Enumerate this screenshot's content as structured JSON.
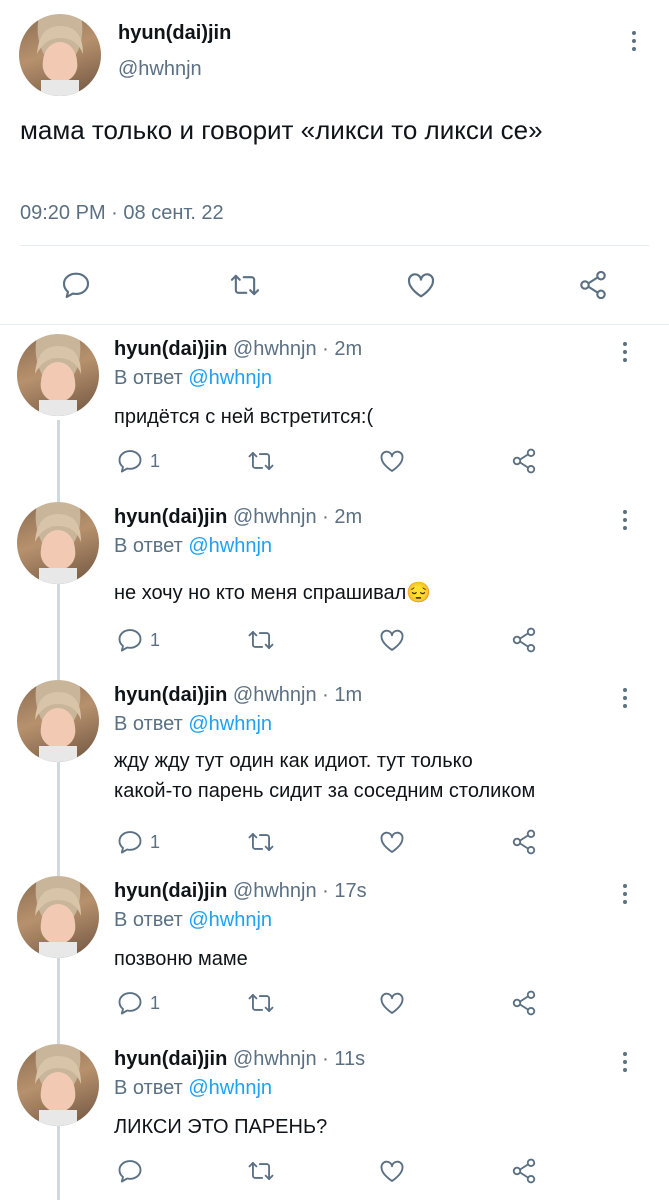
{
  "main_tweet": {
    "name": "hyun(dai)jin",
    "handle": "@hwhnjn",
    "text": "мама только и говорит «ликси то ликси се»",
    "time": "09:20 PM",
    "sep": "·",
    "date": "08 сент. 22"
  },
  "icons": {
    "reply": "reply-icon",
    "retweet": "retweet-icon",
    "like": "heart-icon",
    "share": "share-icon",
    "more": "more-vertical-icon"
  },
  "colors": {
    "link": "#1da1f2",
    "muted": "#5b7083",
    "divider": "#e6ecf0"
  },
  "replies": [
    {
      "name": "hyun(dai)jin",
      "handle": "@hwhnjn",
      "sep": "·",
      "age": "2m",
      "reply_prefix": "В ответ",
      "reply_to": "@hwhnjn",
      "lines": [
        "придётся с ней встретится:("
      ],
      "reply_count": "1"
    },
    {
      "name": "hyun(dai)jin",
      "handle": "@hwhnjn",
      "sep": "·",
      "age": "2m",
      "reply_prefix": "В ответ",
      "reply_to": "@hwhnjn",
      "lines": [
        "не хочу но кто меня спрашивал😔"
      ],
      "reply_count": "1"
    },
    {
      "name": "hyun(dai)jin",
      "handle": "@hwhnjn",
      "sep": "·",
      "age": "1m",
      "reply_prefix": "В ответ",
      "reply_to": "@hwhnjn",
      "lines": [
        "жду жду тут один как идиот. тут только",
        "какой-то парень сидит за соседним столиком"
      ],
      "reply_count": "1"
    },
    {
      "name": "hyun(dai)jin",
      "handle": "@hwhnjn",
      "sep": "·",
      "age": "17s",
      "reply_prefix": "В ответ",
      "reply_to": "@hwhnjn",
      "lines": [
        "позвоню маме"
      ],
      "reply_count": "1"
    },
    {
      "name": "hyun(dai)jin",
      "handle": "@hwhnjn",
      "sep": "·",
      "age": "11s",
      "reply_prefix": "В ответ",
      "reply_to": "@hwhnjn",
      "lines": [
        "ЛИКСИ ЭТО ПАРЕНЬ?"
      ],
      "reply_count": ""
    }
  ]
}
